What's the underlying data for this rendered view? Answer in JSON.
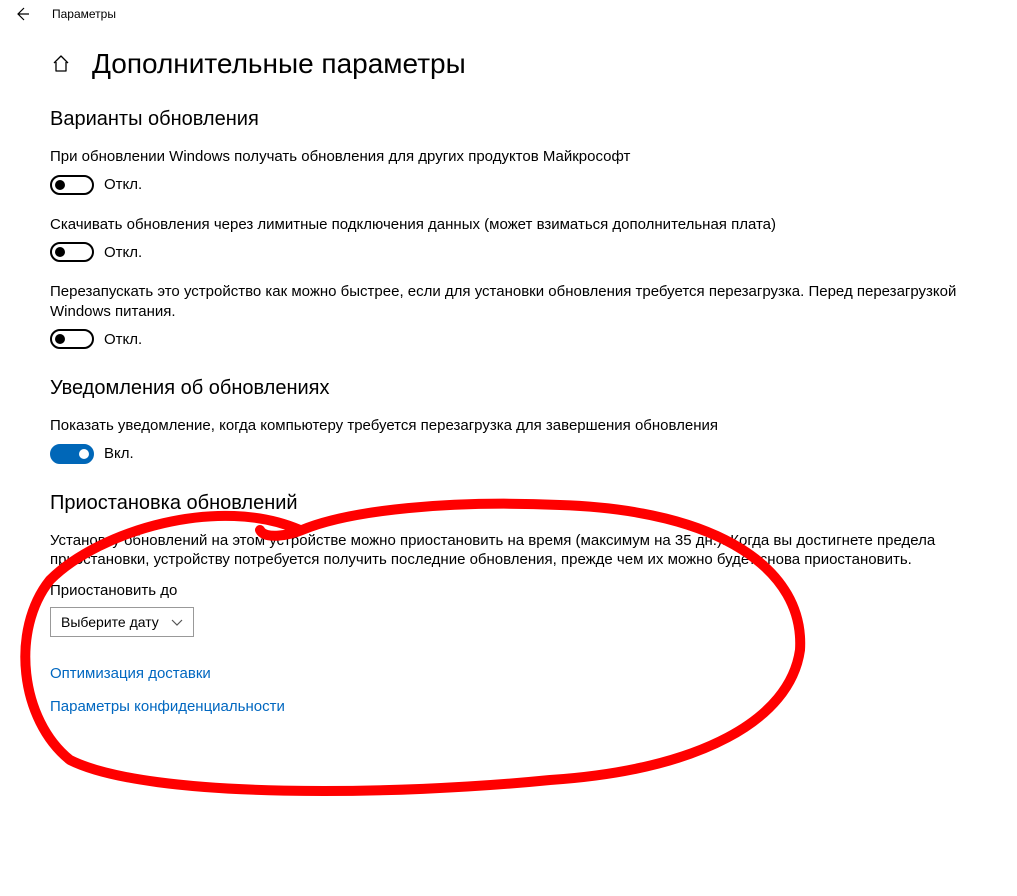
{
  "titlebar": {
    "label": "Параметры"
  },
  "page": {
    "title": "Дополнительные параметры"
  },
  "sections": {
    "update_options": {
      "title": "Варианты обновления",
      "items": {
        "other_products": {
          "text": "При обновлении Windows получать обновления для других продуктов Майкрософт",
          "state_label": "Откл."
        },
        "metered": {
          "text": "Скачивать обновления через лимитные подключения данных (может взиматься дополнительная плата)",
          "state_label": "Откл."
        },
        "restart_asap": {
          "text": "Перезапускать это устройство как можно быстрее, если для установки обновления требуется перезагрузка. Перед перезагрузкой Windows питания.",
          "state_label": "Откл."
        }
      }
    },
    "notifications": {
      "title": "Уведомления об обновлениях",
      "item": {
        "text": "Показать уведомление, когда компьютеру требуется перезагрузка для завершения обновления",
        "state_label": "Вкл."
      }
    },
    "pause": {
      "title": "Приостановка обновлений",
      "description": "Установку обновлений на этом устройстве можно приостановить на время (максимум на 35 дн.). Когда вы достигнете предела приостановки, устройству потребуется получить последние обновления, прежде чем их можно будет снова приостановить.",
      "field_label": "Приостановить до",
      "select_placeholder": "Выберите дату"
    }
  },
  "links": {
    "delivery": "Оптимизация доставки",
    "privacy": "Параметры конфиденциальности"
  }
}
